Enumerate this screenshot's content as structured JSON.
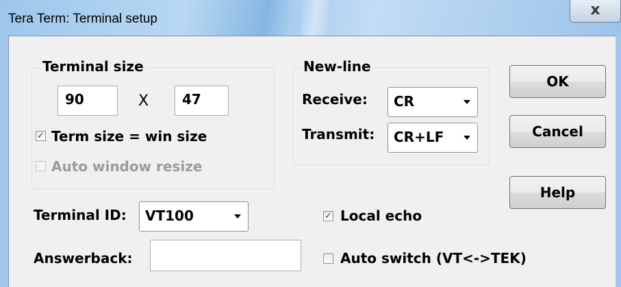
{
  "window": {
    "title": "Tera Term: Terminal setup",
    "close_glyph": "x"
  },
  "terminal_size": {
    "group_label": "Terminal size",
    "width": "90",
    "separator": "X",
    "height": "47",
    "term_size_win_size": {
      "label": "Term size = win size",
      "checked": true,
      "check_glyph": "✓"
    },
    "auto_window_resize": {
      "label": "Auto window resize",
      "checked": false,
      "enabled": false
    }
  },
  "new_line": {
    "group_label": "New-line",
    "receive_label": "Receive:",
    "receive_value": "CR",
    "transmit_label": "Transmit:",
    "transmit_value": "CR+LF"
  },
  "buttons": {
    "ok": "OK",
    "cancel": "Cancel",
    "help": "Help"
  },
  "terminal_id": {
    "label": "Terminal ID:",
    "value": "VT100"
  },
  "answerback": {
    "label": "Answerback:",
    "value": ""
  },
  "local_echo": {
    "label": "Local echo",
    "checked": true,
    "check_glyph": "✓"
  },
  "auto_switch": {
    "label": "Auto switch (VT<->TEK)",
    "checked": false
  }
}
